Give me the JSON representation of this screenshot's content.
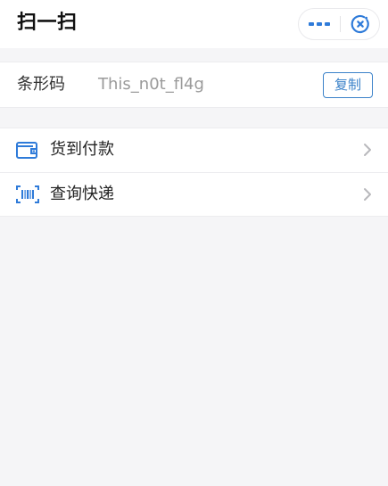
{
  "header": {
    "title": "扫一扫",
    "more_icon": "more-dots-icon",
    "close_icon": "close-circle-icon",
    "accent_color": "#2f7bd9"
  },
  "barcode": {
    "label": "条形码",
    "value": "This_n0t_fl4g",
    "copy_label": "复制"
  },
  "menu": {
    "items": [
      {
        "label": "货到付款",
        "icon": "wallet-icon"
      },
      {
        "label": "查询快递",
        "icon": "barcode-scan-icon"
      }
    ]
  }
}
